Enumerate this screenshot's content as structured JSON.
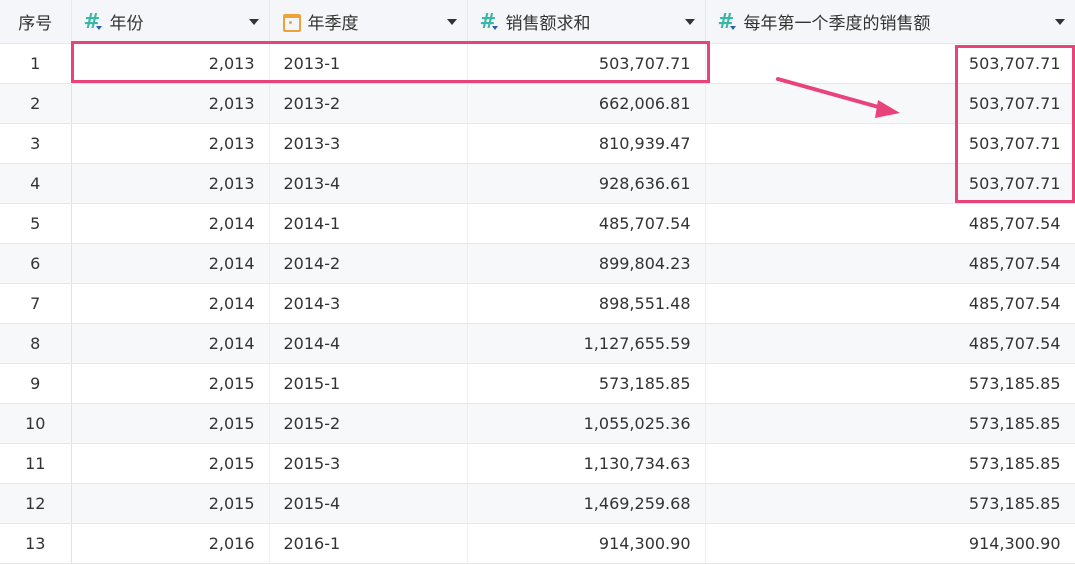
{
  "headers": {
    "index": "序号",
    "year": "年份",
    "quarter": "年季度",
    "sales": "销售额求和",
    "first_q_sales": "每年第一个季度的销售额"
  },
  "rows": [
    {
      "index": "1",
      "year": "2,013",
      "quarter": "2013-1",
      "sales": "503,707.71",
      "first_q": "503,707.71"
    },
    {
      "index": "2",
      "year": "2,013",
      "quarter": "2013-2",
      "sales": "662,006.81",
      "first_q": "503,707.71"
    },
    {
      "index": "3",
      "year": "2,013",
      "quarter": "2013-3",
      "sales": "810,939.47",
      "first_q": "503,707.71"
    },
    {
      "index": "4",
      "year": "2,013",
      "quarter": "2013-4",
      "sales": "928,636.61",
      "first_q": "503,707.71"
    },
    {
      "index": "5",
      "year": "2,014",
      "quarter": "2014-1",
      "sales": "485,707.54",
      "first_q": "485,707.54"
    },
    {
      "index": "6",
      "year": "2,014",
      "quarter": "2014-2",
      "sales": "899,804.23",
      "first_q": "485,707.54"
    },
    {
      "index": "7",
      "year": "2,014",
      "quarter": "2014-3",
      "sales": "898,551.48",
      "first_q": "485,707.54"
    },
    {
      "index": "8",
      "year": "2,014",
      "quarter": "2014-4",
      "sales": "1,127,655.59",
      "first_q": "485,707.54"
    },
    {
      "index": "9",
      "year": "2,015",
      "quarter": "2015-1",
      "sales": "573,185.85",
      "first_q": "573,185.85"
    },
    {
      "index": "10",
      "year": "2,015",
      "quarter": "2015-2",
      "sales": "1,055,025.36",
      "first_q": "573,185.85"
    },
    {
      "index": "11",
      "year": "2,015",
      "quarter": "2015-3",
      "sales": "1,130,734.63",
      "first_q": "573,185.85"
    },
    {
      "index": "12",
      "year": "2,015",
      "quarter": "2015-4",
      "sales": "1,469,259.68",
      "first_q": "573,185.85"
    },
    {
      "index": "13",
      "year": "2,016",
      "quarter": "2016-1",
      "sales": "914,300.90",
      "first_q": "914,300.90"
    }
  ],
  "icons": {
    "year": "number-field-icon",
    "quarter": "date-field-icon",
    "sales": "number-field-icon",
    "first_q_sales": "number-field-icon"
  },
  "colors": {
    "annotation": "#e8437a",
    "number_icon": "#3ab8a6",
    "date_icon": "#f0a23a",
    "header_bg": "#f4f6f9",
    "alt_row_bg": "#f7f8fa"
  }
}
